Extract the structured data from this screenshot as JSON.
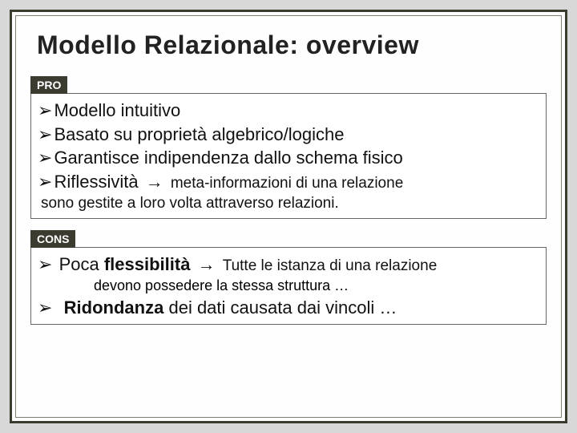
{
  "title": "Modello Relazionale: overview",
  "pro": {
    "label": "PRO",
    "items": {
      "i1": "Modello intuitivo",
      "i2": "Basato su proprietà algebrico/logiche",
      "i3": "Garantisce indipendenza dallo schema fisico",
      "i4a": "Riflessività",
      "i4b": "meta-informazioni di una relazione",
      "sub": "sono gestite a loro volta attraverso relazioni."
    }
  },
  "cons": {
    "label": "CONS",
    "items": {
      "c1a": "Poca",
      "c1b": "flessibilità",
      "c1c": "Tutte le istanza di una relazione",
      "c1sub": "devono possedere la stessa struttura …",
      "c2a": "Ridondanza",
      "c2b": "dei dati causata dai vincoli …"
    }
  },
  "glyphs": {
    "bullet": "➢",
    "arrow": "→"
  }
}
